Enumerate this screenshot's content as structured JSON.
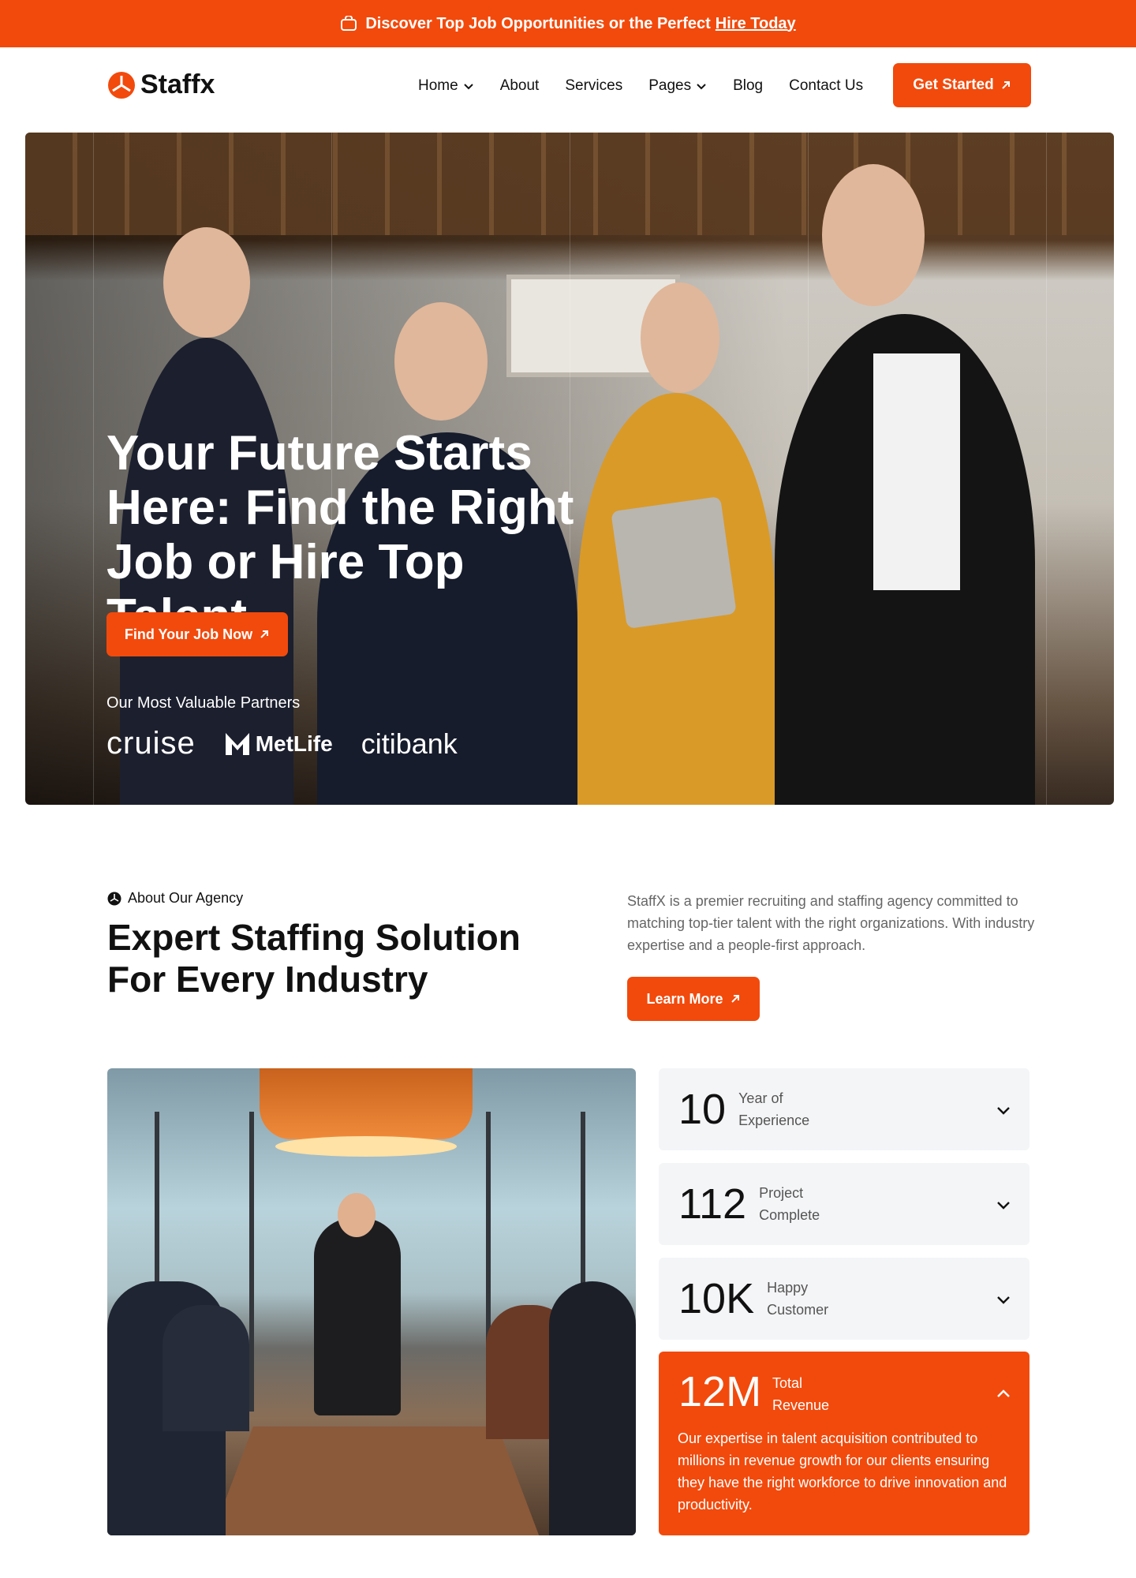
{
  "announcement": {
    "text": "Discover Top Job Opportunities or the Perfect",
    "link": "Hire Today"
  },
  "header": {
    "logo": "Staffx",
    "nav": [
      {
        "label": "Home",
        "dropdown": true
      },
      {
        "label": "About",
        "dropdown": false
      },
      {
        "label": "Services",
        "dropdown": false
      },
      {
        "label": "Pages",
        "dropdown": true
      },
      {
        "label": "Blog",
        "dropdown": false
      },
      {
        "label": "Contact Us",
        "dropdown": false
      }
    ],
    "cta": "Get Started"
  },
  "hero": {
    "title": "Your Future Starts Here: Find the Right Job or Hire Top Talent",
    "cta": "Find Your Job Now",
    "partners_label": "Our Most Valuable Partners",
    "partners": [
      "cruise",
      "MetLife",
      "citibank"
    ]
  },
  "about": {
    "eyebrow": "About Our Agency",
    "title": "Expert Staffing Solution For Every Industry",
    "description": "StaffX is a premier recruiting and staffing agency committed to matching top-tier talent with the right organizations. With industry expertise and a people-first approach.",
    "cta": "Learn More"
  },
  "stats": [
    {
      "value": "10",
      "label": "Year of Experience",
      "expanded": false
    },
    {
      "value": "112",
      "label": "Project Complete",
      "expanded": false
    },
    {
      "value": "10K",
      "label": "Happy Customer",
      "expanded": false
    },
    {
      "value": "12M",
      "label": "Total Revenue",
      "expanded": true,
      "body": "Our expertise in talent acquisition  contributed to millions in revenue growth for our clients ensuring they have the right workforce to drive innovation and productivity."
    }
  ],
  "colors": {
    "accent": "#f24a0c",
    "text": "#111111",
    "muted": "#666666",
    "panel": "#f4f5f7"
  }
}
